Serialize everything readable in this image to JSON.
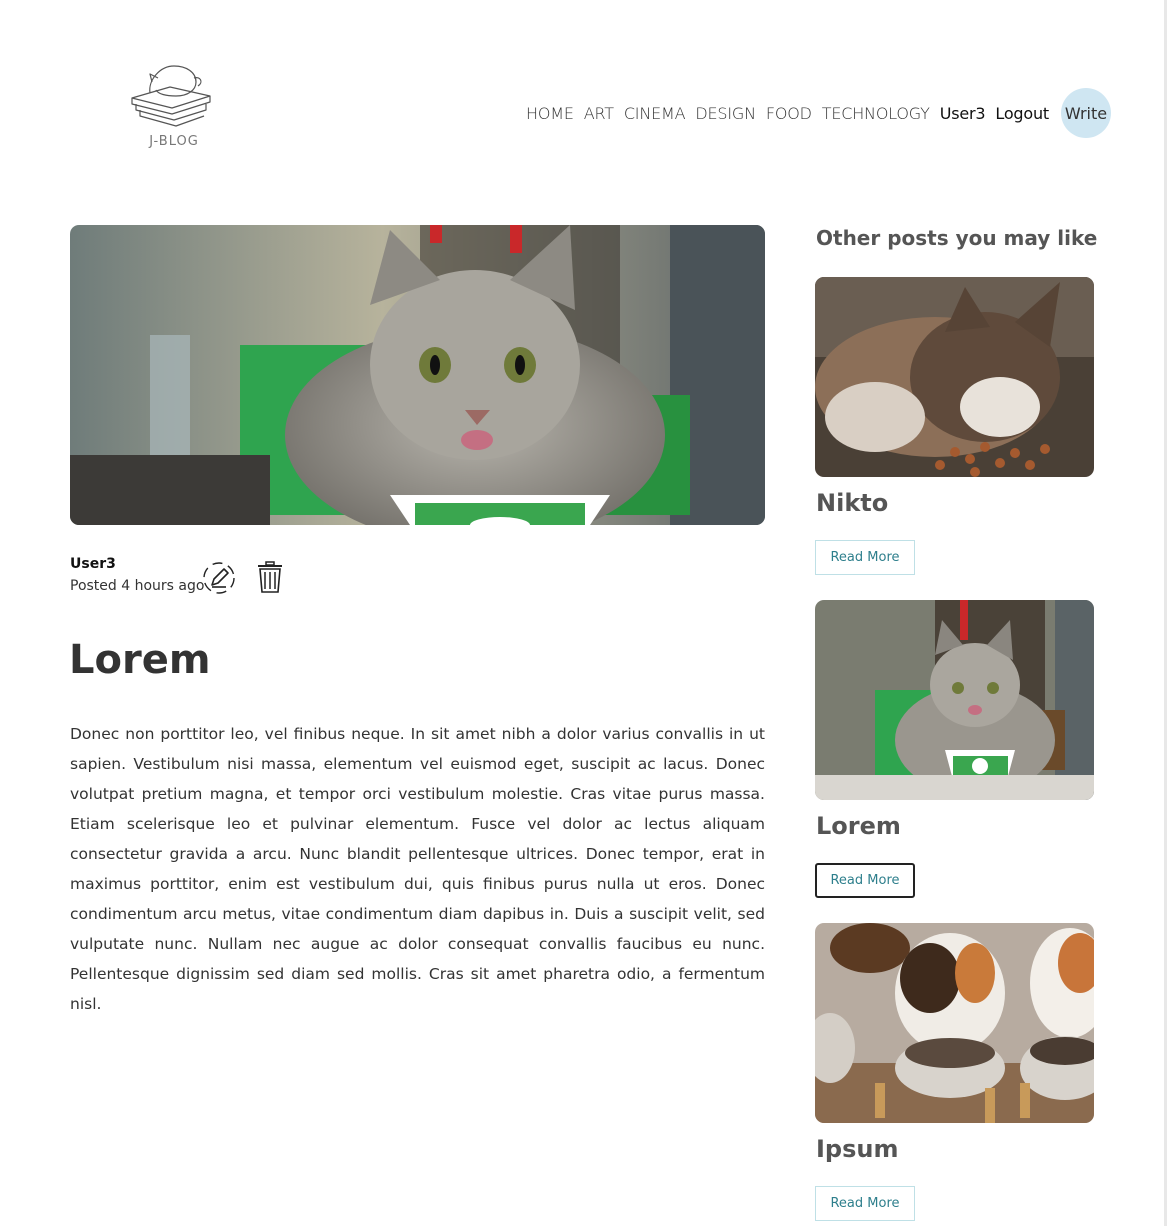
{
  "header": {
    "logo_text": "J-BLOG",
    "nav": [
      "HOME",
      "ART",
      "CINEMA",
      "DESIGN",
      "FOOD",
      "TECHNOLOGY"
    ],
    "user": "User3",
    "logout": "Logout",
    "write": "Write"
  },
  "post": {
    "author": "User3",
    "posted": "Posted 4 hours ago",
    "title": "Lorem",
    "body": "Donec non porttitor leo, vel finibus neque. In sit amet nibh a dolor varius convallis in ut sapien. Vestibulum nisi massa, elementum vel euismod eget, suscipit ac lacus. Donec volutpat pretium magna, et tempor orci vestibulum molestie. Cras vitae purus massa. Etiam scelerisque leo et pulvinar elementum. Fusce vel dolor ac lectus aliquam consectetur gravida a arcu. Nunc blandit pellentesque ultrices. Donec tempor, erat in maximus porttitor, enim est vestibulum dui, quis finibus purus nulla ut eros. Donec condimentum arcu metus, vitae condimentum diam dapibus in. Duis a suscipit velit, sed vulputate nunc. Nullam nec augue ac dolor consequat convallis faucibus eu nunc. Pellentesque dignissim sed diam sed mollis. Cras sit amet pharetra odio, a fermentum nisl."
  },
  "sidebar": {
    "title": "Other posts you may like",
    "posts": [
      {
        "title": "Nikto",
        "button": "Read More"
      },
      {
        "title": "Lorem",
        "button": "Read More"
      },
      {
        "title": "Ipsum",
        "button": "Read More"
      }
    ]
  },
  "colors": {
    "write_bg": "#cfe6f2",
    "read_more_text": "#2e7f8c",
    "read_more_border": "#bfe0e6"
  }
}
